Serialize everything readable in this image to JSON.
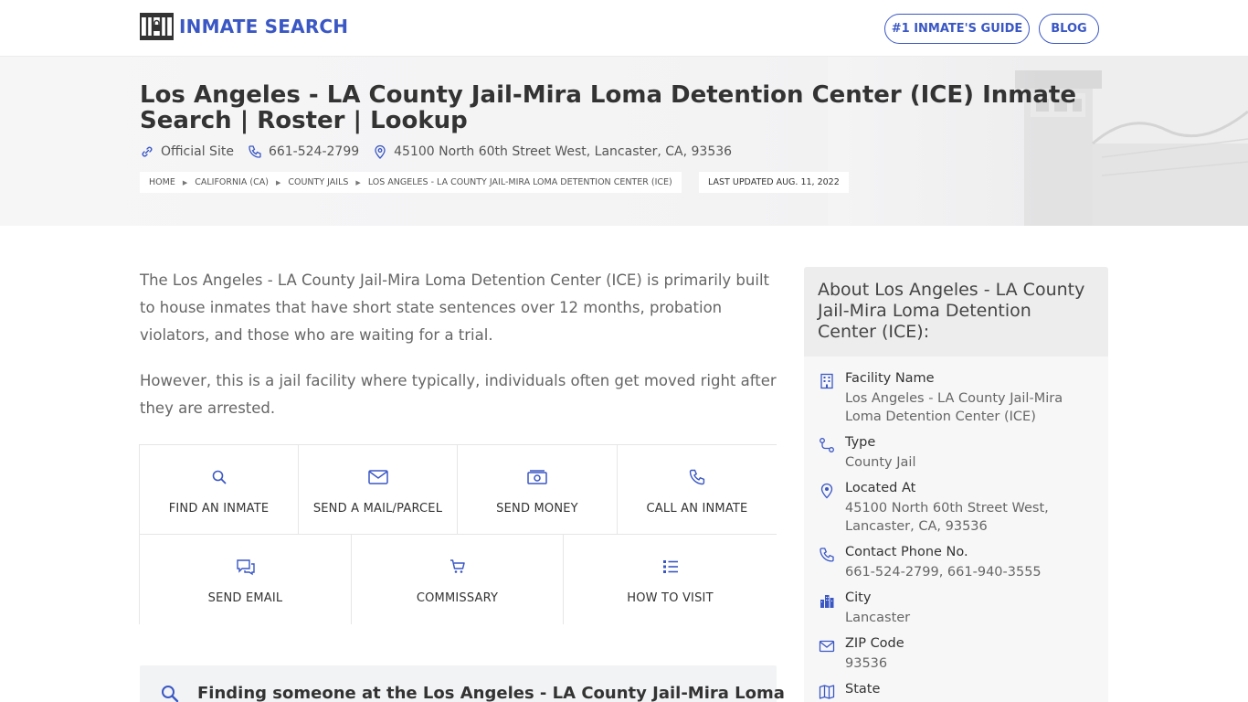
{
  "header": {
    "logo_text": "INMATE SEARCH",
    "nav": [
      {
        "label": "#1 INMATE'S GUIDE"
      },
      {
        "label": "BLOG"
      }
    ]
  },
  "hero": {
    "title": "Los Angeles - LA County Jail-Mira Loma Detention Center (ICE) Inmate Search | Roster | Lookup",
    "official_site": "Official Site",
    "phone": "661-524-2799",
    "address": "45100 North 60th Street West, Lancaster, CA, 93536",
    "breadcrumbs": [
      "HOME",
      "CALIFORNIA (CA)",
      "COUNTY JAILS",
      "LOS ANGELES - LA COUNTY JAIL-MIRA LOMA DETENTION CENTER (ICE)"
    ],
    "last_updated": "LAST UPDATED AUG. 11, 2022"
  },
  "main": {
    "para1": "The Los Angeles - LA County Jail-Mira Loma Detention Center (ICE) is primarily built to house inmates that have short state sentences over 12 months, probation violators, and those who are waiting for a trial.",
    "para2": "However, this is a jail facility where typically, individuals often get moved right after they are arrested.",
    "actions": [
      {
        "label": "FIND AN INMATE",
        "icon": "search-icon"
      },
      {
        "label": "SEND A MAIL/PARCEL",
        "icon": "mail-icon"
      },
      {
        "label": "SEND MONEY",
        "icon": "money-icon"
      },
      {
        "label": "CALL AN INMATE",
        "icon": "phone-icon"
      },
      {
        "label": "SEND EMAIL",
        "icon": "chat-icon"
      },
      {
        "label": "COMMISSARY",
        "icon": "cart-icon"
      },
      {
        "label": "HOW TO VISIT",
        "icon": "list-icon"
      }
    ],
    "finding_heading": "Finding someone at the Los Angeles - LA County Jail-Mira Loma"
  },
  "sidebar": {
    "heading": "About Los Angeles - LA County Jail-Mira Loma Detention Center (ICE):",
    "items": [
      {
        "key": "Facility Name",
        "value": "Los Angeles - LA County Jail-Mira Loma Detention Center (ICE)",
        "icon": "building-icon"
      },
      {
        "key": "Type",
        "value": "County Jail",
        "icon": "route-icon"
      },
      {
        "key": "Located At",
        "value": "45100 North 60th Street West, Lancaster, CA, 93536",
        "icon": "map-pin-icon"
      },
      {
        "key": "Contact Phone No.",
        "value": "661-524-2799, 661-940-3555",
        "icon": "phone-icon"
      },
      {
        "key": "City",
        "value": "Lancaster",
        "icon": "city-icon"
      },
      {
        "key": "ZIP Code",
        "value": "93536",
        "icon": "envelope-icon"
      },
      {
        "key": "State",
        "value": "",
        "icon": "map-icon"
      }
    ]
  },
  "colors": {
    "brand": "#3a57c4",
    "text": "#333333",
    "muted": "#666666"
  }
}
